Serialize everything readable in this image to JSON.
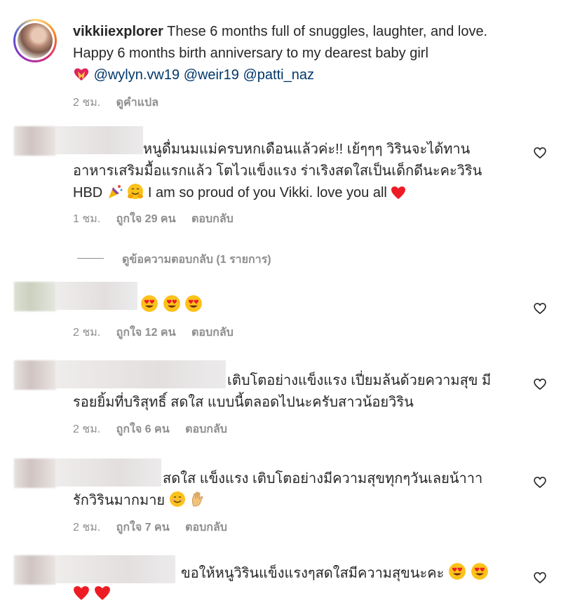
{
  "post": {
    "username": "vikkiiexplorer",
    "caption": " These 6 months full of snuggles, laughter, and love. Happy 6 months birth anniversary to my dearest baby girl ",
    "mentions": [
      "@wylyn.vw19",
      "@weir19",
      "@patti_naz"
    ],
    "time": "2 ชม.",
    "translate_label": "ดูคำแปล"
  },
  "comments": [
    {
      "text_line1": "หนูดื่มนมแม่ครบหกเดือนแล้วค่ะ!! เย้ๆๆๆ วิรินจะได้ทาน",
      "text_line2": "อาหารเสริมมื้อแรกแล้ว โตไวแข็งแรง ร่าเริงสดใสเป็นเด็กดีนะคะวิริน",
      "text_line3": "HBD",
      "text_line3b": " I am so proud of you Vikki. love you all ",
      "time": "1 ชม.",
      "likes": "ถูกใจ 29 คน",
      "reply": "ตอบกลับ"
    },
    {
      "text_line1": "",
      "time": "2 ชม.",
      "likes": "ถูกใจ 12 คน",
      "reply": "ตอบกลับ"
    },
    {
      "text_line1": "เติบโตอย่างแข็งแรง เปี่ยมล้นด้วยความสุข มี",
      "text_line2": "รอยยิ้มที่บริสุทธิ์ สดใส แบบนี้ตลอดไปนะครับสาวน้อยวิริน",
      "time": "2 ชม.",
      "likes": "ถูกใจ 6 คน",
      "reply": "ตอบกลับ"
    },
    {
      "text_line1": "สดใส แข็งแรง เติบโตอย่างมีความสุขทุกๆวันเลยน้าาา",
      "text_line2": "รักวิรินมากมาย",
      "time": "2 ชม.",
      "likes": "ถูกใจ 7 คน",
      "reply": "ตอบกลับ"
    },
    {
      "text_line1": "ขอให้หนูวิรินแข็งแรงๆสดใสมีความสุขนะคะ"
    }
  ],
  "view_replies": "ดูข้อความตอบกลับ (1 รายการ)",
  "icons": [
    "heart-outline-icon",
    "heart-emoji",
    "smiling-face-heart-eyes-emoji",
    "party-popper-emoji",
    "hugging-face-emoji",
    "smiling-face-emoji",
    "hand-emoji",
    "heart-with-ribbon-emoji"
  ],
  "colors": {
    "text": "#262626",
    "secondary": "#8e8e8e",
    "mention": "#00376b",
    "heart": "#ed1c24"
  }
}
